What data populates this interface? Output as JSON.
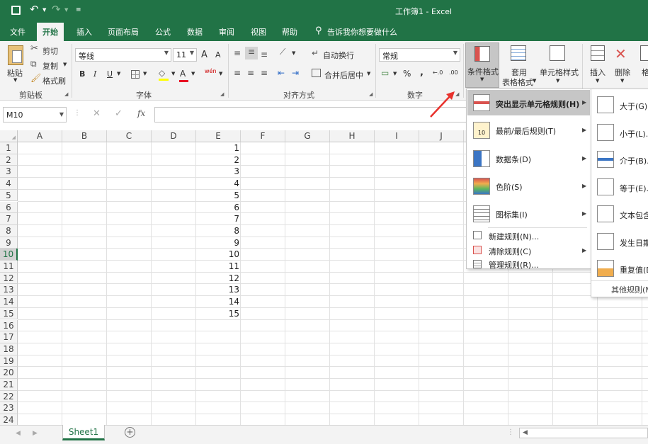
{
  "title": "工作簿1 - Excel",
  "qat": {
    "save": "save-icon",
    "undo": "undo-icon",
    "redo": "redo-icon"
  },
  "tabs": [
    "文件",
    "开始",
    "插入",
    "页面布局",
    "公式",
    "数据",
    "审阅",
    "视图",
    "帮助"
  ],
  "tell_me": "告诉我你想要做什么",
  "clipboard": {
    "paste": "粘贴",
    "cut": "剪切",
    "copy": "复制",
    "painter": "格式刷",
    "label": "剪贴板"
  },
  "font": {
    "name": "等线",
    "size": "11",
    "label": "字体",
    "grow": "A",
    "shrink": "A",
    "bold": "B",
    "italic": "I",
    "underline": "U",
    "color_a": "A",
    "wen": "wén"
  },
  "alignment": {
    "wrap": "自动换行",
    "merge": "合并后居中",
    "label": "对齐方式"
  },
  "number": {
    "format": "常规",
    "percent": "%",
    "comma": ",",
    "label": "数字",
    "inc": "←.0",
    "dec": ".00"
  },
  "styles": {
    "cond": "条件格式",
    "table_line1": "套用",
    "table_line2": "表格格式",
    "cell_styles": "单元格样式"
  },
  "cells": {
    "insert": "插入",
    "delete": "删除",
    "format": "格"
  },
  "namebox": "M10",
  "fx": "fx",
  "columns": [
    "A",
    "B",
    "C",
    "D",
    "E",
    "F",
    "G",
    "H",
    "I",
    "J"
  ],
  "rows": [
    "1",
    "2",
    "3",
    "4",
    "5",
    "6",
    "7",
    "8",
    "9",
    "10",
    "11",
    "12",
    "13",
    "14",
    "15",
    "16",
    "17",
    "18",
    "19",
    "20",
    "21",
    "22",
    "23",
    "24"
  ],
  "e_values": [
    "1",
    "2",
    "3",
    "4",
    "5",
    "6",
    "7",
    "8",
    "9",
    "10",
    "11",
    "12",
    "13",
    "14",
    "15"
  ],
  "sheet": "Sheet1",
  "cf_menu": [
    "突出显示单元格规则(H)",
    "最前/最后规则(T)",
    "数据条(D)",
    "色阶(S)",
    "图标集(I)",
    "新建规则(N)...",
    "清除规则(C)",
    "管理规则(R)..."
  ],
  "sub_menu": [
    "大于(G)...",
    "小于(L)...",
    "介于(B)...",
    "等于(E)...",
    "文本包含",
    "发生日期",
    "重复值(D)",
    "其他规则(M)"
  ],
  "colors": {
    "excel_green": "#217346",
    "ribbon": "#f3f3f3",
    "arrow": "#e8322d",
    "menu_hover": "#c6c6c6"
  }
}
